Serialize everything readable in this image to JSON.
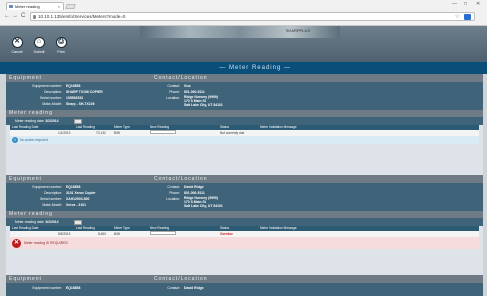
{
  "browser": {
    "tab_title": "Meter reading",
    "tab_close": "×",
    "url": "10.10.1.135/eInfo/Services/Meters?mode=0",
    "nav_back": "←",
    "nav_forward": "→",
    "nav_refresh": "C",
    "win_min": "—",
    "win_max": "□",
    "win_close": "✕",
    "star": "☆"
  },
  "toolbar": {
    "cancel_label": "Cancel",
    "cancel_icon": "✕",
    "submit_label": "Submit",
    "submit_icon": "⌂",
    "print_label": "Print",
    "print_icon": "⎙",
    "masthead_text": "SHARPPLUS"
  },
  "page_title": "— Meter Reading —",
  "sections": [
    {
      "equipment_header": "Equipment",
      "contact_header": "Contact/Location",
      "equipment": [
        {
          "label": "Equipment number:",
          "value": "EQ16858"
        },
        {
          "label": "Description:",
          "value": "SHARP TX106 COPIER"
        },
        {
          "label": "Serial number:",
          "value": "105593533"
        },
        {
          "label": "Make-Model:",
          "value": "Sharp - SH-TX106"
        }
      ],
      "contact": [
        {
          "label": "Contact:",
          "value": "Gus"
        },
        {
          "label": "Phone:",
          "value": "801-000-5111"
        },
        {
          "label": "Location:",
          "value": "Ridge Nursery (9999)"
        },
        {
          "label": "",
          "value": "170 S Main St"
        },
        {
          "label": "",
          "value": "Salt Lake City, UT 84101"
        }
      ],
      "reading_header": "Meter reading",
      "reading_date_label": "Meter reading date:",
      "reading_date": "3/2/2014",
      "columns": [
        "Last Reading Date",
        "Last Reading",
        "Meter Type",
        "New Reading",
        "Status",
        "Meter Validation Message"
      ],
      "row": {
        "date": "1/1/2013",
        "last": "70,132",
        "type": "B/W",
        "status": "Not currently due",
        "message": ""
      },
      "msg_type": "info",
      "msg_icon": "i",
      "msg": "No action required."
    },
    {
      "equipment_header": "Equipment",
      "contact_header": "Contact/Location",
      "equipment": [
        {
          "label": "Equipment number:",
          "value": "EQ16858"
        },
        {
          "label": "Description:",
          "value": "3101 Xerox Copier"
        },
        {
          "label": "Serial number:",
          "value": "XAH12503-800"
        },
        {
          "label": "Make-Model:",
          "value": "Xerox - 3101"
        }
      ],
      "contact": [
        {
          "label": "Contact:",
          "value": "David Ridge"
        },
        {
          "label": "Phone:",
          "value": "801-000-5111"
        },
        {
          "label": "Location:",
          "value": "Ridge Nursery (9999)"
        },
        {
          "label": "",
          "value": "170 S Main St"
        },
        {
          "label": "",
          "value": "Salt Lake City, UT 84101"
        }
      ],
      "reading_header": "Meter reading",
      "reading_date_label": "Meter reading date:",
      "reading_date": "3/2/2014",
      "columns": [
        "Last Reading Date",
        "Last Reading",
        "Meter Type",
        "New Reading",
        "Status",
        "Meter Validation Message"
      ],
      "row": {
        "date": "5/5/2013",
        "last": "8,450",
        "type": "B/W",
        "status": "Overdue",
        "message": ""
      },
      "msg_type": "error",
      "msg_icon": "✕",
      "msg": "Meter reading IS REQUIRED"
    }
  ],
  "section3": {
    "equipment_header": "Equipment",
    "contact_header": "Contact/Location",
    "equipment": [
      {
        "label": "Equipment number:",
        "value": "EQ16858"
      }
    ],
    "contact": [
      {
        "label": "Contact:",
        "value": "David Ridge"
      }
    ]
  }
}
